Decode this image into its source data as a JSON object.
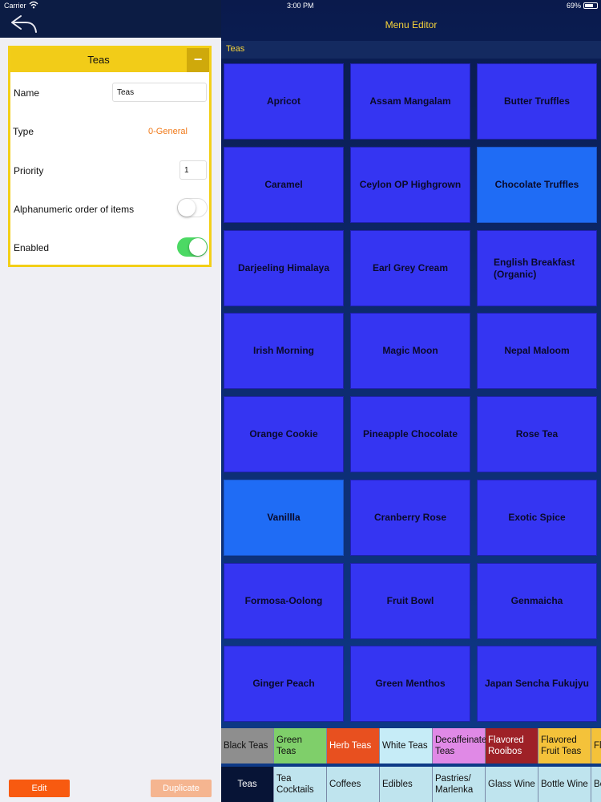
{
  "status_bar": {
    "carrier": "Carrier",
    "time": "3:00 PM",
    "battery": "69%",
    "battery_level": 0.69
  },
  "left_panel": {
    "card": {
      "title": "Teas",
      "collapse_label": "−",
      "name_label": "Name",
      "name_value": "Teas",
      "type_label": "Type",
      "type_value": "0-General",
      "priority_label": "Priority",
      "priority_value": "1",
      "alpha_order_label": "Alphanumeric order of items",
      "alpha_order_on": false,
      "enabled_label": "Enabled",
      "enabled_on": true
    },
    "edit_button": "Edit",
    "duplicate_button": "Duplicate"
  },
  "right_panel": {
    "title": "Menu Editor",
    "breadcrumb": "Teas",
    "tiles": [
      {
        "label": "Apricot",
        "selected": false
      },
      {
        "label": "Assam Mangalam",
        "selected": false
      },
      {
        "label": "Butter Truffles",
        "selected": false
      },
      {
        "label": "Caramel",
        "selected": false
      },
      {
        "label": "Ceylon OP Highgrown",
        "selected": false
      },
      {
        "label": "Chocolate Truffles",
        "selected": true
      },
      {
        "label": "Darjeeling Himalaya",
        "selected": false
      },
      {
        "label": "Earl Grey Cream",
        "selected": false
      },
      {
        "label": "English Breakfast (Organic)",
        "selected": false
      },
      {
        "label": "Irish Morning",
        "selected": false
      },
      {
        "label": "Magic Moon",
        "selected": false
      },
      {
        "label": "Nepal Maloom",
        "selected": false
      },
      {
        "label": "Orange Cookie",
        "selected": false
      },
      {
        "label": "Pineapple Chocolate",
        "selected": false
      },
      {
        "label": "Rose Tea",
        "selected": false
      },
      {
        "label": "Vanillla",
        "selected": true
      },
      {
        "label": "Cranberry Rose",
        "selected": false
      },
      {
        "label": "Exotic Spice",
        "selected": false
      },
      {
        "label": "Formosa-Oolong",
        "selected": false
      },
      {
        "label": "Fruit Bowl",
        "selected": false
      },
      {
        "label": "Genmaicha",
        "selected": false
      },
      {
        "label": "Ginger Peach",
        "selected": false
      },
      {
        "label": "Green Menthos",
        "selected": false
      },
      {
        "label": "Japan Sencha Fukujyu",
        "selected": false
      }
    ],
    "category_row1": [
      {
        "label": "Black Teas",
        "bg": "#8e8e8e",
        "fg": "#111111"
      },
      {
        "label": "Green Teas",
        "bg": "#7fcf6a",
        "fg": "#111111"
      },
      {
        "label": "Herb Teas",
        "bg": "#e8501f",
        "fg": "#ffffff"
      },
      {
        "label": "White Teas",
        "bg": "#c6ecf7",
        "fg": "#111111"
      },
      {
        "label": "Decaffeinated Teas",
        "bg": "#e089e6",
        "fg": "#111111"
      },
      {
        "label": "Flavored Rooibos",
        "bg": "#9e2127",
        "fg": "#ffffff"
      },
      {
        "label": "Flavored Fruit Teas",
        "bg": "#f4c23a",
        "fg": "#111111"
      },
      {
        "label": "Fl Cl",
        "bg": "#f4c23a",
        "fg": "#111111"
      }
    ],
    "category_row2": [
      {
        "label": "Teas",
        "bg": "#071436",
        "fg": "#ffffff"
      },
      {
        "label": "Tea Cocktails",
        "bg": "#bfe4ee",
        "fg": "#111111"
      },
      {
        "label": "Coffees",
        "bg": "#bfe4ee",
        "fg": "#111111"
      },
      {
        "label": "Edibles",
        "bg": "#bfe4ee",
        "fg": "#111111"
      },
      {
        "label": "Pastries/ Marlenka",
        "bg": "#bfe4ee",
        "fg": "#111111"
      },
      {
        "label": "Glass Wine",
        "bg": "#bfe4ee",
        "fg": "#111111"
      },
      {
        "label": "Bottle Wine",
        "bg": "#bfe4ee",
        "fg": "#111111"
      },
      {
        "label": "Be",
        "bg": "#bfe4ee",
        "fg": "#111111"
      }
    ]
  }
}
